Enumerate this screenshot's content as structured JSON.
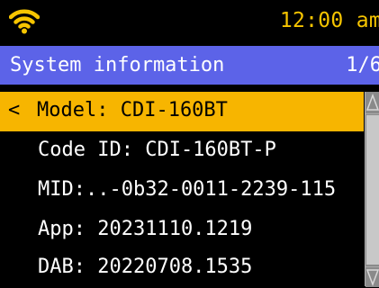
{
  "status_bar": {
    "time": "12:00 am",
    "wifi_icon": "wifi-icon",
    "accent_color": "#f7c500"
  },
  "header": {
    "title": "System information",
    "page_indicator": "1/6",
    "background_color": "#5c63e8"
  },
  "menu": {
    "back_indicator": "<",
    "selected_color": "#f7b500",
    "items": [
      {
        "label": "Model: CDI-160BT",
        "selected": true
      },
      {
        "label": "Code ID: CDI-160BT-P",
        "selected": false
      },
      {
        "label": "MID:..-0b32-0011-2239-115",
        "selected": false
      },
      {
        "label": "App: 20231110.1219",
        "selected": false
      },
      {
        "label": "DAB: 20220708.1535",
        "selected": false
      }
    ]
  },
  "scrollbar": {
    "up_icon": "triangle-up-icon",
    "down_icon": "triangle-down-icon"
  }
}
